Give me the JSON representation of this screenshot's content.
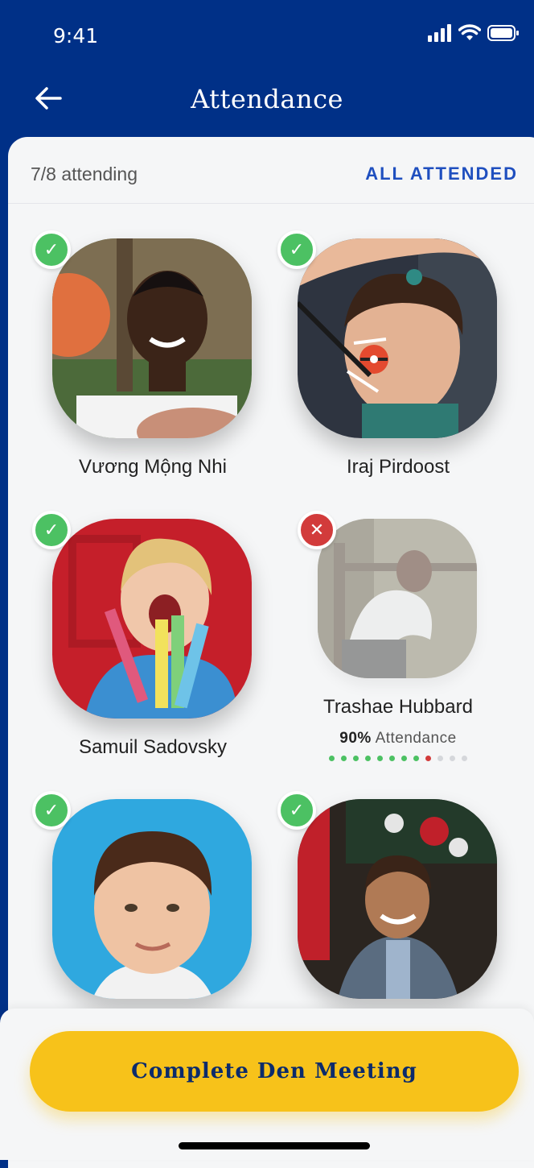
{
  "status_bar": {
    "time": "9:41",
    "icons": [
      "cellular-signal-icon",
      "wifi-icon",
      "battery-icon"
    ]
  },
  "nav": {
    "title": "Attendance",
    "back_icon": "arrow-left-icon"
  },
  "summary": {
    "attending": "7/8 attending",
    "all_attended_label": "ALL ATTENDED"
  },
  "scouts": [
    {
      "name": "Vương Mộng Nhi",
      "status": "present"
    },
    {
      "name": "Iraj Pirdoost",
      "status": "present"
    },
    {
      "name": "Samuil Sadovsky",
      "status": "present"
    },
    {
      "name": "Trashae Hubbard",
      "status": "absent",
      "attendance_pct": "90%",
      "attendance_label": "Attendance",
      "history": [
        "present",
        "present",
        "present",
        "present",
        "present",
        "present",
        "present",
        "present",
        "absent",
        "none",
        "none",
        "none"
      ]
    },
    {
      "name": "",
      "status": "present"
    },
    {
      "name": "",
      "status": "present"
    }
  ],
  "footer": {
    "complete_button_label": "Complete Den Meeting"
  },
  "colors": {
    "brand_blue": "#003087",
    "present_green": "#4cc163",
    "absent_red": "#d23b3b",
    "accent_yellow": "#f7c21a",
    "link_blue": "#1f4fbf"
  }
}
